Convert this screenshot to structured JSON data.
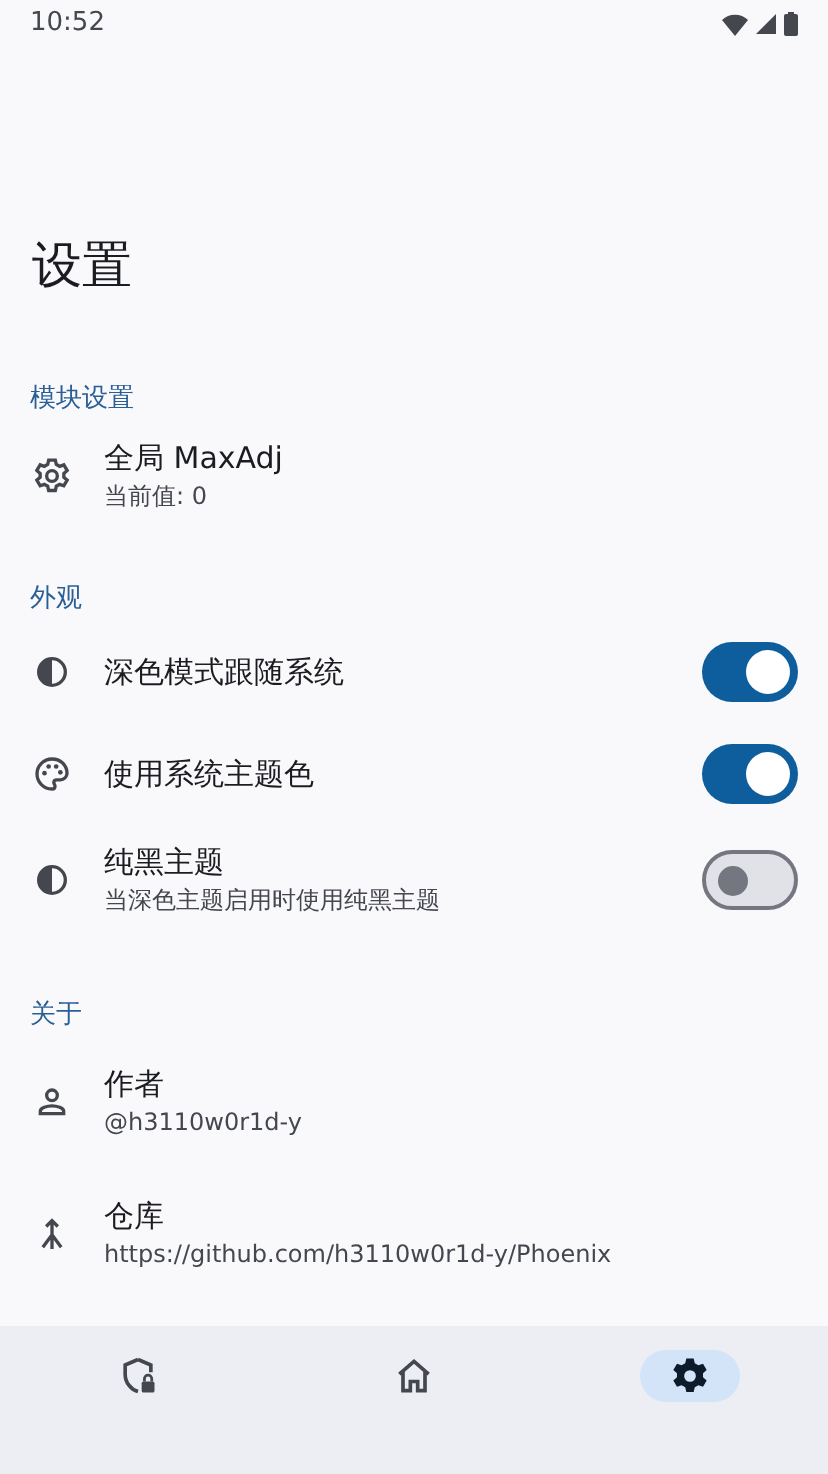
{
  "status_bar": {
    "time": "10:52"
  },
  "title": "设置",
  "sections": [
    {
      "header": "模块设置",
      "items": [
        {
          "kind": "text",
          "title": "全局 MaxAdj",
          "subtitle": "当前值: 0"
        }
      ]
    },
    {
      "header": "外观",
      "items": [
        {
          "kind": "switch",
          "title": "深色模式跟随系统",
          "on": true
        },
        {
          "kind": "switch",
          "title": "使用系统主题色",
          "on": true
        },
        {
          "kind": "switch",
          "title": "纯黑主题",
          "subtitle": "当深色主题启用时使用纯黑主题",
          "on": false
        }
      ]
    },
    {
      "header": "关于",
      "items": [
        {
          "kind": "text",
          "title": "作者",
          "subtitle": "@h3110w0r1d-y"
        },
        {
          "kind": "text",
          "title": "仓库",
          "subtitle": "https://github.com/h3110w0r1d-y/Phoenix"
        }
      ]
    }
  ],
  "bottom_nav": [
    {
      "selected": false
    },
    {
      "selected": false
    },
    {
      "selected": true
    }
  ]
}
